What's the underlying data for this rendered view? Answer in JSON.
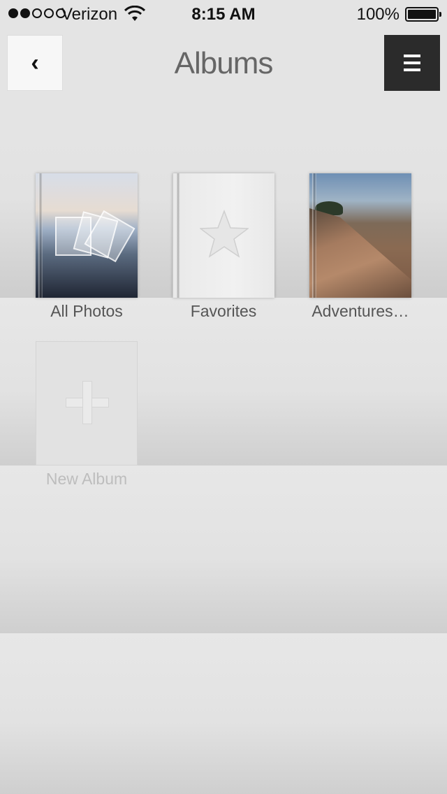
{
  "status_bar": {
    "carrier": "Verizon",
    "time": "8:15 AM",
    "battery": "100%",
    "signal_bars_filled": 2,
    "signal_bars_total": 5
  },
  "nav": {
    "back_label": "‹",
    "title": "Albums"
  },
  "albums": [
    {
      "label": "All Photos"
    },
    {
      "label": "Favorites"
    },
    {
      "label": "Adventures…"
    },
    {
      "label": "New Album"
    }
  ],
  "icons": {
    "back": "chevron-left-icon",
    "menu": "hamburger-menu-icon",
    "favorites": "star-icon",
    "new_album": "plus-icon",
    "wifi": "wifi-icon",
    "battery": "battery-icon"
  },
  "colors": {
    "menu_button": "#2b2b2b",
    "background": "#e4e4e4",
    "label": "#555555",
    "faded_label": "#bdbdbd"
  }
}
